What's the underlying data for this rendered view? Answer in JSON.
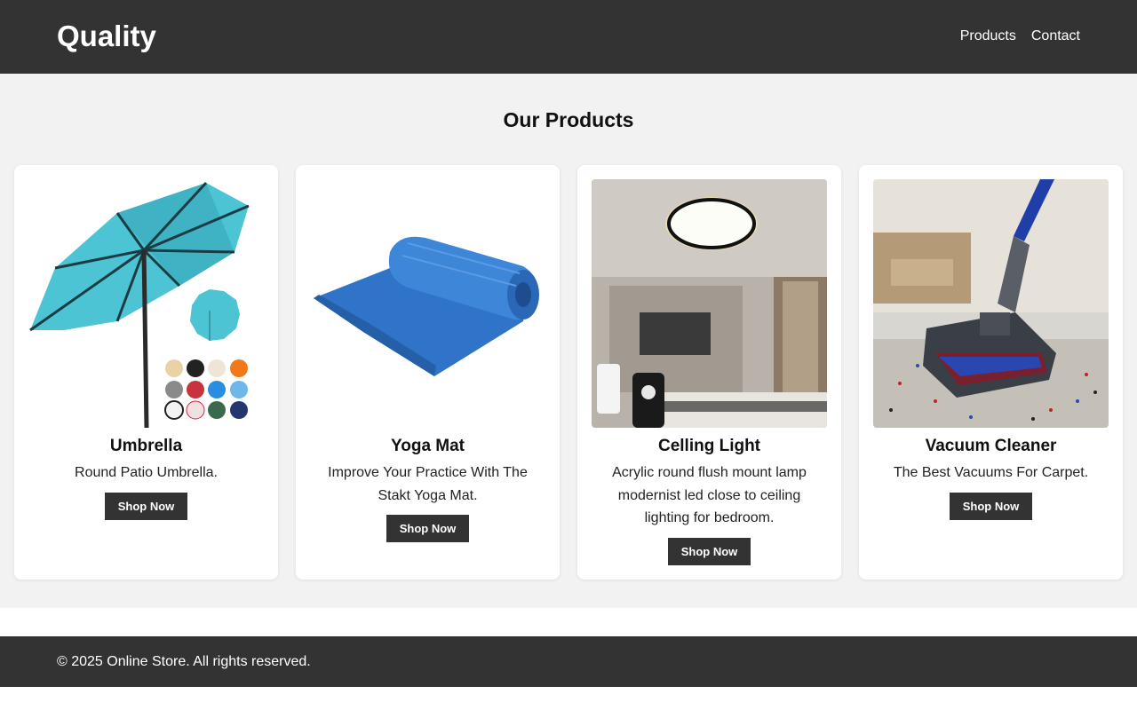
{
  "header": {
    "logo": "Quality",
    "nav": [
      "Products",
      "Contact"
    ]
  },
  "main": {
    "title": "Our Products",
    "products": [
      {
        "name": "Umbrella",
        "description": "Round Patio Umbrella.",
        "button": "Shop Now",
        "image_icon": "umbrella-image"
      },
      {
        "name": "Yoga Mat",
        "description": "Improve Your Practice With The Stakt Yoga Mat.",
        "button": "Shop Now",
        "image_icon": "yoga-mat-image"
      },
      {
        "name": "Celling Light",
        "description": "Acrylic round flush mount lamp modernist led close to ceiling lighting for bedroom.",
        "button": "Shop Now",
        "image_icon": "ceiling-light-image"
      },
      {
        "name": "Vacuum Cleaner",
        "description": "The Best Vacuums For Carpet.",
        "button": "Shop Now",
        "image_icon": "vacuum-cleaner-image"
      }
    ]
  },
  "footer": {
    "copyright": "© 2025 Online Store. All rights reserved."
  },
  "colors": {
    "header_bg": "#333333",
    "main_bg": "#f2f2f2",
    "button_bg": "#333333"
  }
}
